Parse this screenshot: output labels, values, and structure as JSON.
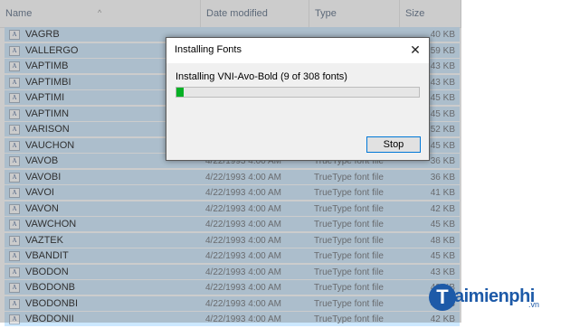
{
  "columns": {
    "name": "Name",
    "date": "Date modified",
    "type": "Type",
    "size": "Size"
  },
  "files": [
    {
      "name": "VAGRB",
      "date": "",
      "type": "",
      "size": "40 KB"
    },
    {
      "name": "VALLERGO",
      "date": "",
      "type": "",
      "size": "59 KB"
    },
    {
      "name": "VAPTIMB",
      "date": "",
      "type": "",
      "size": "43 KB"
    },
    {
      "name": "VAPTIMBI",
      "date": "",
      "type": "",
      "size": "43 KB"
    },
    {
      "name": "VAPTIMI",
      "date": "",
      "type": "",
      "size": "45 KB"
    },
    {
      "name": "VAPTIMN",
      "date": "",
      "type": "",
      "size": "45 KB"
    },
    {
      "name": "VARISON",
      "date": "",
      "type": "",
      "size": "52 KB"
    },
    {
      "name": "VAUCHON",
      "date": "",
      "type": "",
      "size": "45 KB"
    },
    {
      "name": "VAVOB",
      "date": "4/22/1993 4:00 AM",
      "type": "TrueType font file",
      "size": "36 KB"
    },
    {
      "name": "VAVOBI",
      "date": "4/22/1993 4:00 AM",
      "type": "TrueType font file",
      "size": "36 KB"
    },
    {
      "name": "VAVOI",
      "date": "4/22/1993 4:00 AM",
      "type": "TrueType font file",
      "size": "41 KB"
    },
    {
      "name": "VAVON",
      "date": "4/22/1993 4:00 AM",
      "type": "TrueType font file",
      "size": "42 KB"
    },
    {
      "name": "VAWCHON",
      "date": "4/22/1993 4:00 AM",
      "type": "TrueType font file",
      "size": "45 KB"
    },
    {
      "name": "VAZTEK",
      "date": "4/22/1993 4:00 AM",
      "type": "TrueType font file",
      "size": "48 KB"
    },
    {
      "name": "VBANDIT",
      "date": "4/22/1993 4:00 AM",
      "type": "TrueType font file",
      "size": "45 KB"
    },
    {
      "name": "VBODON",
      "date": "4/22/1993 4:00 AM",
      "type": "TrueType font file",
      "size": "43 KB"
    },
    {
      "name": "VBODONB",
      "date": "4/22/1993 4:00 AM",
      "type": "TrueType font file",
      "size": "42 KB"
    },
    {
      "name": "VBODONBI",
      "date": "4/22/1993 4:00 AM",
      "type": "TrueType font file",
      "size": "41 KB"
    },
    {
      "name": "VBODONII",
      "date": "4/22/1993 4:00 AM",
      "type": "TrueType font file",
      "size": "42 KB"
    }
  ],
  "dialog": {
    "title": "Installing Fonts",
    "close_glyph": "✕",
    "message": "Installing VNI-Avo-Bold (9 of 308 fonts)",
    "progress": 0.03,
    "stop_label": "Stop"
  },
  "watermark": {
    "letter": "T",
    "text": "aimienphi",
    "suffix": ".vn"
  },
  "colors": {
    "selection": "#cce8ff",
    "progress_fill": "#06b025",
    "button_border": "#0078d7",
    "watermark": "#1d5aa8"
  }
}
